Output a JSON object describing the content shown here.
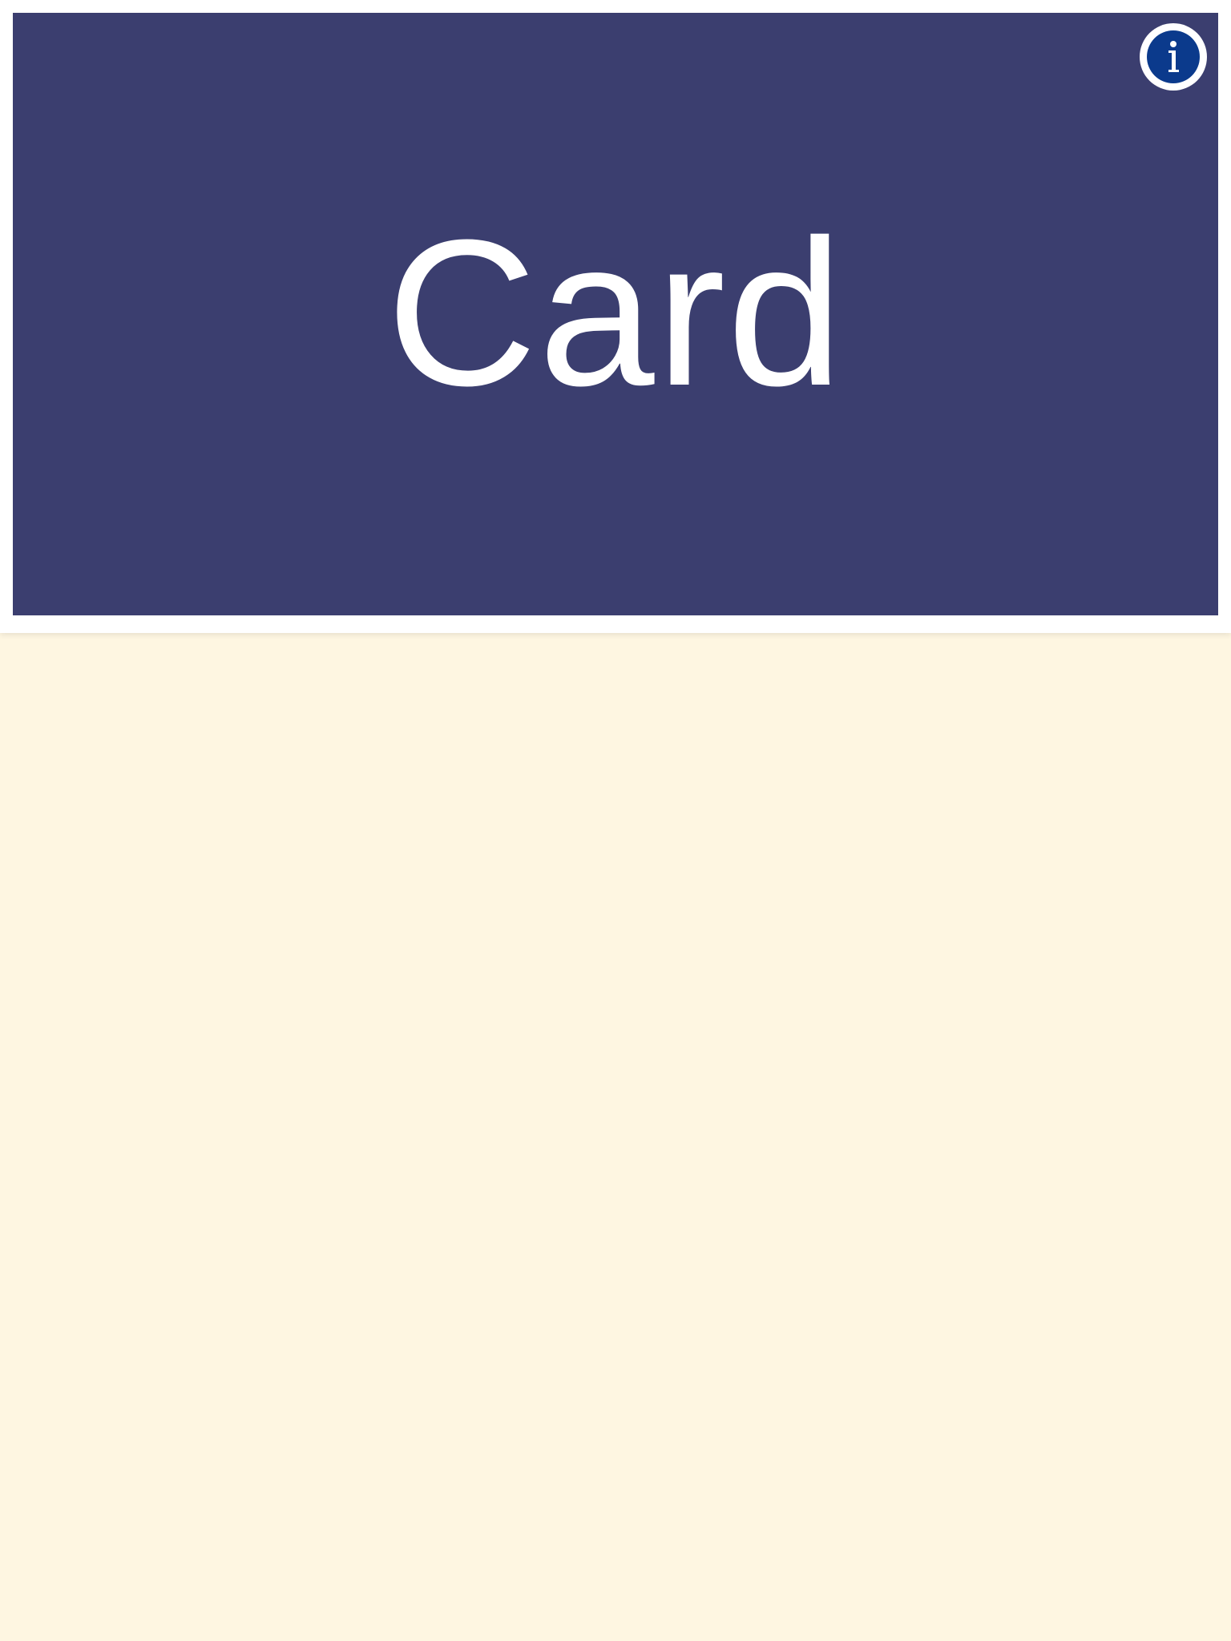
{
  "card": {
    "title": "Card",
    "face_color": "#3B3E6F",
    "text_color": "#FFFFFF"
  },
  "info_button": {
    "icon": "info-icon",
    "color": "#0B3A8C"
  },
  "colors": {
    "background": "#FEF6E1",
    "frame": "#FFFFFF"
  }
}
